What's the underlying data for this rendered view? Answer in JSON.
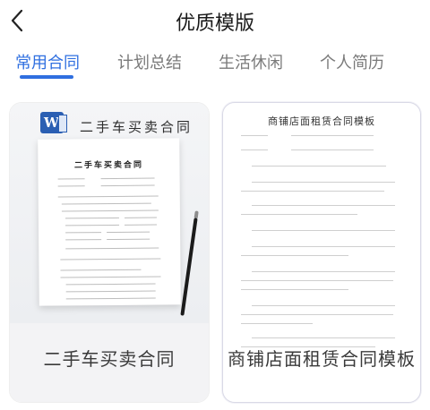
{
  "header": {
    "title": "优质模版",
    "back_icon": "chevron-left-icon"
  },
  "tabs": [
    {
      "label": "常用合同",
      "active": true
    },
    {
      "label": "计划总结",
      "active": false
    },
    {
      "label": "生活休闲",
      "active": false
    },
    {
      "label": "个人简历",
      "active": false
    }
  ],
  "accent_color": "#2f6fe0",
  "cards": [
    {
      "label": "二手车买卖合同",
      "photo_heading": "二手车买卖合同",
      "doc_heading": "二手车买卖合同",
      "icon": "word-icon",
      "icon_letter": "W"
    },
    {
      "label": "商铺店面租赁合同模板",
      "doc_heading": "商铺店面租赁合同模板"
    }
  ]
}
